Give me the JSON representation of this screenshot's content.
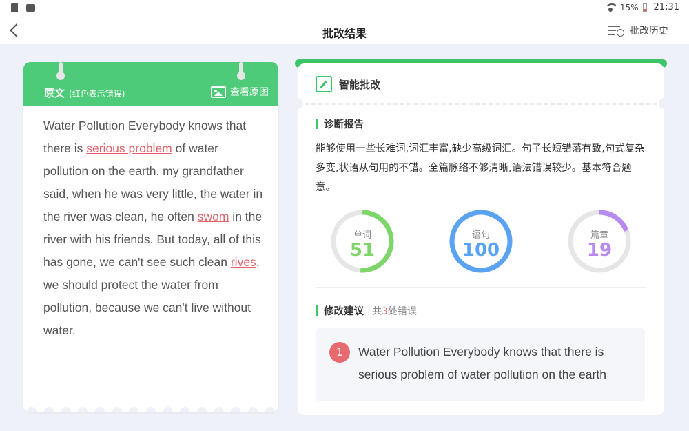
{
  "status_bar": {
    "battery": "15%",
    "time": "21:31"
  },
  "header": {
    "title": "批改结果",
    "history_label": "批改历史"
  },
  "left_card": {
    "title": "原文",
    "hint": "(红色表示错误)",
    "view_original": "查看原图",
    "segments": [
      {
        "text": "Water Pollution  Everybody knows that there is ",
        "error": false
      },
      {
        "text": "serious problem",
        "error": true
      },
      {
        "text": " of water pollution on the earth. my grandfather said, when he was very little, the water in the river was clean, he often ",
        "error": false
      },
      {
        "text": "swom",
        "error": true
      },
      {
        "text": " in the river with his friends.  But today, all of this has gone, we can't see such clean ",
        "error": false
      },
      {
        "text": "rives",
        "error": true
      },
      {
        "text": ", we should protect the water from pollution, because we can't live without water.",
        "error": false
      }
    ]
  },
  "right_card": {
    "smart_title": "智能批改",
    "report_title": "诊断报告",
    "report_text": "能够使用一些长难词,词汇丰富,缺少高级词汇。句子长短错落有致,句式复杂多变,状语从句用的不错。全篇脉络不够清晰,语法错误较少。基本符合题意。",
    "gauges": [
      {
        "label": "单词",
        "value": 51,
        "max": 100,
        "color": "#7ed66a"
      },
      {
        "label": "语句",
        "value": 100,
        "max": 100,
        "color": "#5aa3f3"
      },
      {
        "label": "篇章",
        "value": 19,
        "max": 100,
        "color": "#b889f0"
      }
    ],
    "suggest_title": "修改建议",
    "suggest_prefix": "共",
    "suggest_count": "3",
    "suggest_suffix": "处错误",
    "suggestion_number": "1",
    "suggestion_text": "Water Pollution  Everybody knows that there is serious problem of water pollution on the earth"
  }
}
